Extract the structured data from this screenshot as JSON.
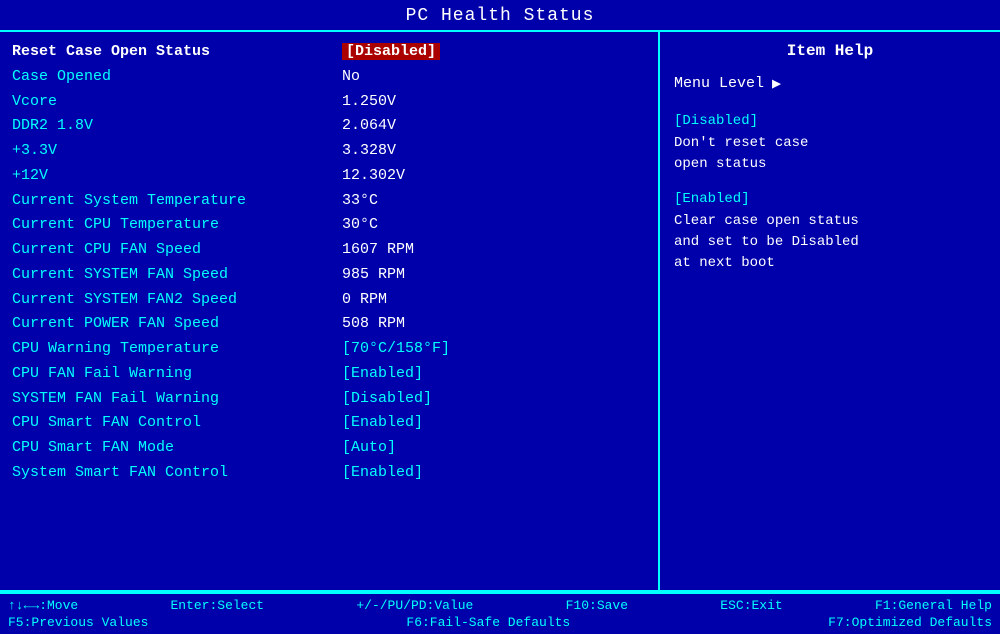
{
  "title": "PC Health Status",
  "left": {
    "rows": [
      {
        "label": "Reset Case Open Status",
        "value": "[Disabled]",
        "type": "highlight-disabled"
      },
      {
        "label": "Case Opened",
        "value": "No",
        "type": "plain"
      },
      {
        "label": "Vcore",
        "value": "1.250V",
        "type": "plain"
      },
      {
        "label": "DDR2 1.8V",
        "value": "2.064V",
        "type": "plain"
      },
      {
        "label": "+3.3V",
        "value": "3.328V",
        "type": "plain"
      },
      {
        "label": "+12V",
        "value": "12.302V",
        "type": "plain"
      },
      {
        "label": "Current System Temperature",
        "value": "33°C",
        "type": "plain"
      },
      {
        "label": "Current CPU Temperature",
        "value": "30°C",
        "type": "plain"
      },
      {
        "label": "Current CPU FAN Speed",
        "value": "1607 RPM",
        "type": "plain"
      },
      {
        "label": "Current SYSTEM FAN Speed",
        "value": "985 RPM",
        "type": "plain"
      },
      {
        "label": "Current SYSTEM FAN2 Speed",
        "value": "0 RPM",
        "type": "plain"
      },
      {
        "label": "Current POWER FAN Speed",
        "value": "508 RPM",
        "type": "plain"
      },
      {
        "label": "CPU Warning Temperature",
        "value": "[70°C/158°F]",
        "type": "bracket"
      },
      {
        "label": "CPU FAN Fail Warning",
        "value": "[Enabled]",
        "type": "bracket"
      },
      {
        "label": "SYSTEM FAN Fail Warning",
        "value": "[Disabled]",
        "type": "bracket"
      },
      {
        "label": "CPU Smart FAN Control",
        "value": "[Enabled]",
        "type": "bracket"
      },
      {
        "label": "CPU Smart FAN Mode",
        "value": "[Auto]",
        "type": "bracket"
      },
      {
        "label": "System Smart FAN Control",
        "value": "[Enabled]",
        "type": "bracket"
      }
    ]
  },
  "right": {
    "title": "Item Help",
    "menu_level_label": "Menu Level",
    "menu_level_arrow": "▶",
    "help_items": [
      {
        "option": "[Disabled]",
        "description": "Don't reset case\nopen status"
      },
      {
        "option": "[Enabled]",
        "description": "Clear case open status\nand set to be Disabled\nat next boot"
      }
    ]
  },
  "bottom": {
    "row1": [
      {
        "key": "↑↓←→:Move",
        "desc": ""
      },
      {
        "key": "Enter:Select",
        "desc": ""
      },
      {
        "key": "+/-/PU/PD:Value",
        "desc": ""
      },
      {
        "key": "F10:Save",
        "desc": ""
      },
      {
        "key": "ESC:Exit",
        "desc": ""
      },
      {
        "key": "F1:General Help",
        "desc": ""
      }
    ],
    "row2": [
      {
        "key": "F5:Previous Values",
        "desc": ""
      },
      {
        "key": "F6:Fail-Safe Defaults",
        "desc": ""
      },
      {
        "key": "F7:Optimized Defaults",
        "desc": ""
      }
    ]
  }
}
